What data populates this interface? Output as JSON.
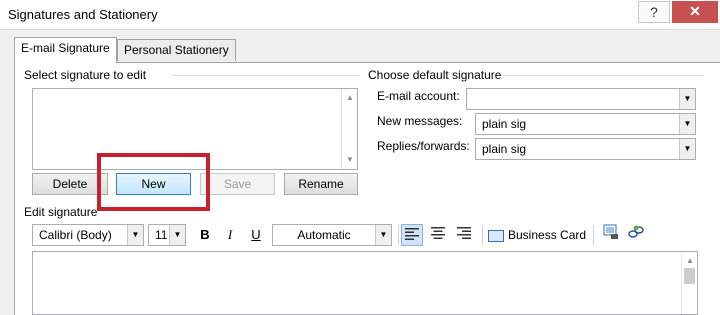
{
  "window": {
    "title": "Signatures and Stationery",
    "help_label": "?",
    "close_label": "✕"
  },
  "tabs": [
    {
      "label": "E-mail Signature",
      "active": true
    },
    {
      "label": "Personal Stationery",
      "active": false
    }
  ],
  "select_signature": {
    "heading": "Select signature to edit",
    "items": []
  },
  "buttons": {
    "delete": "Delete",
    "new": "New",
    "save": "Save",
    "rename": "Rename"
  },
  "defaults": {
    "heading": "Choose default signature",
    "email_account_label": "E-mail account:",
    "email_account_value": "",
    "new_messages_label": "New messages:",
    "new_messages_value": "plain sig",
    "replies_label": "Replies/forwards:",
    "replies_value": "plain sig"
  },
  "edit_signature": {
    "heading": "Edit signature",
    "font": "Calibri (Body)",
    "size": "11",
    "bold": "B",
    "italic": "I",
    "underline": "U",
    "color": "Automatic",
    "business_card": "Business Card"
  },
  "colors": {
    "highlight_box": "#c8202d",
    "close_button": "#c75050",
    "default_button": "#bee6fd"
  },
  "icons": [
    "help-icon",
    "close-icon",
    "scroll-up-icon",
    "scroll-down-icon",
    "dropdown-arrow-icon",
    "align-left-icon",
    "align-center-icon",
    "align-right-icon",
    "business-card-icon",
    "insert-picture-icon",
    "insert-hyperlink-icon"
  ]
}
